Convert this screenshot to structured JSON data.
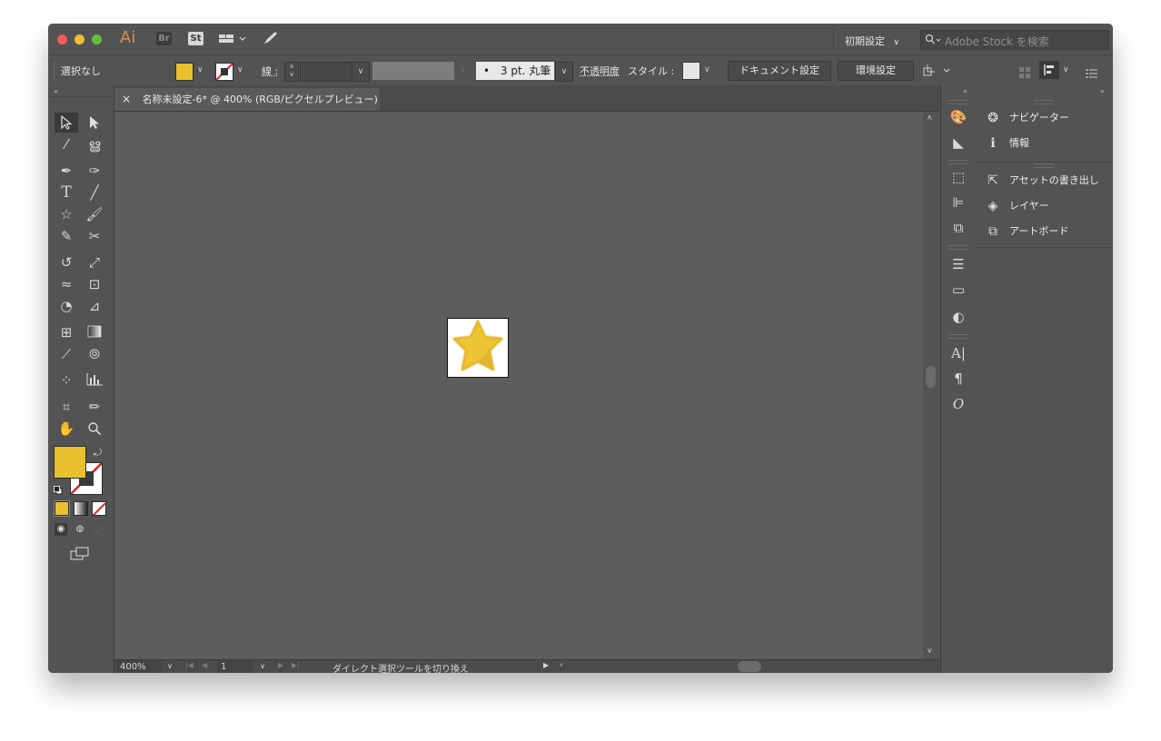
{
  "app": {
    "badge": "Ai",
    "bridge_badge": "Br",
    "stock_badge": "St"
  },
  "titlebar": {
    "workspace": "初期設定",
    "search_placeholder": "Adobe Stock を検索"
  },
  "control_bar": {
    "selection_status": "選択なし",
    "stroke_label": "線 :",
    "brush_label": "3 pt. 丸筆",
    "brush_dot": "•",
    "opacity_label": "不透明度",
    "style_label": "スタイル :",
    "document_setup_button": "ドキュメント設定",
    "preferences_button": "環境設定"
  },
  "document": {
    "tab_title": "名称未設定-6* @ 400% (RGB/ピクセルプレビュー)",
    "close_glyph": "×"
  },
  "status_bar": {
    "zoom": "400%",
    "artboard_number": "1",
    "status_text": "ダイレクト選択ツールを切り換え"
  },
  "panels": {
    "group1": [
      {
        "icon": "navigator-icon",
        "glyph": "❂",
        "label": "ナビゲーター"
      },
      {
        "icon": "info-icon",
        "glyph": "ℹ",
        "label": "情報"
      }
    ],
    "group2": [
      {
        "icon": "export-icon",
        "glyph": "⇱",
        "label": "アセットの書き出し"
      },
      {
        "icon": "layers-icon",
        "glyph": "◈",
        "label": "レイヤー"
      },
      {
        "icon": "artboards-icon",
        "glyph": "⧉",
        "label": "アートボード"
      }
    ]
  },
  "colors": {
    "fill": "#e9c12e",
    "star": "#edc535",
    "ui_bg": "#535353",
    "canvas": "#5d5d5d"
  }
}
